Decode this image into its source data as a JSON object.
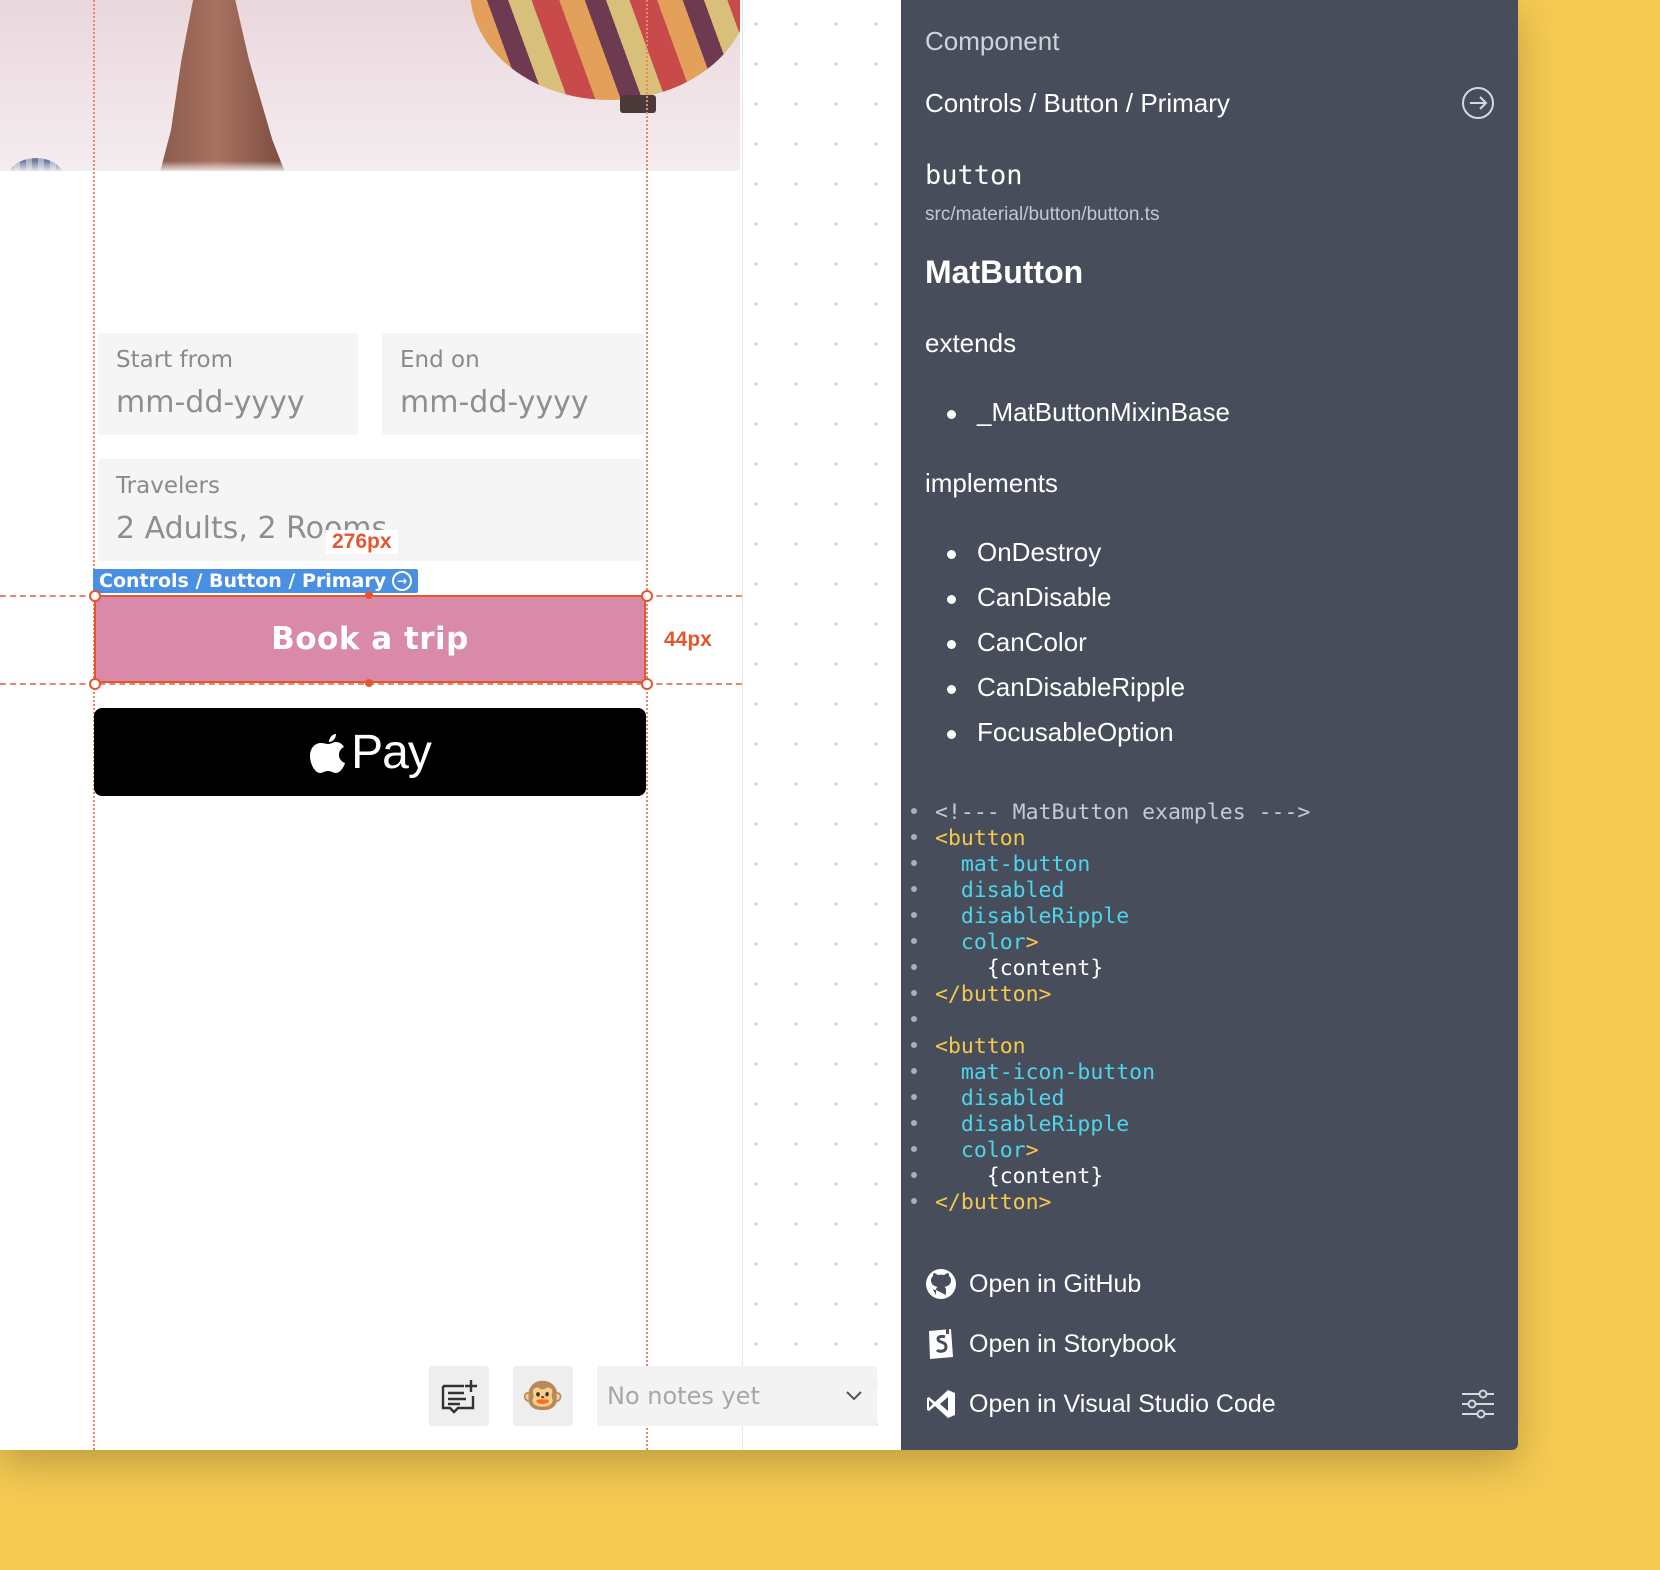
{
  "form": {
    "start_label": "Start from",
    "start_placeholder": "mm-dd-yyyy",
    "end_label": "End on",
    "end_placeholder": "mm-dd-yyyy",
    "travelers_label": "Travelers",
    "travelers_value": "2 Adults, 2 Rooms",
    "book_button": "Book a trip",
    "apple_pay_label": "Pay"
  },
  "inspector": {
    "component_tag": "Controls / Button / Primary",
    "width_measure": "276px",
    "height_measure": "44px"
  },
  "toolbar": {
    "notes_placeholder": "No notes yet",
    "avatar_emoji": "🐵"
  },
  "panel": {
    "heading": "Component",
    "component_path": "Controls / Button / Primary",
    "selector": "button",
    "file_path": "src/material/button/button.ts",
    "class_name": "MatButton",
    "extends_label": "extends",
    "extends_items": [
      "_MatButtonMixinBase"
    ],
    "implements_label": "implements",
    "implements_items": [
      "OnDestroy",
      "CanDisable",
      "CanColor",
      "CanDisableRipple",
      "FocusableOption"
    ],
    "code": {
      "comment": "<!--- MatButton examples --->",
      "open_tag": "<button",
      "attr_mat_button": "mat-button",
      "attr_mat_icon_button": "mat-icon-button",
      "attr_disabled": "disabled",
      "attr_disable_ripple": "disableRipple",
      "attr_color": "color",
      "tag_close_bracket": ">",
      "content": "{content}",
      "close_tag": "</button>"
    },
    "links": {
      "github": "Open in GitHub",
      "storybook": "Open in Storybook",
      "vscode": "Open in Visual Studio Code"
    }
  },
  "colors": {
    "background": "#f5ca52",
    "panel": "#484d5b",
    "primary_button": "#d98aa9",
    "measure": "#e4572e",
    "component_tag": "#4a90e2",
    "code_tag": "#f5c94b",
    "code_attr": "#4fd5e9"
  },
  "icons": [
    "goto-circle-arrow-icon",
    "github-icon",
    "storybook-icon",
    "vscode-icon",
    "settings-sliders-icon",
    "apple-logo-icon",
    "add-note-icon",
    "chevron-down-icon"
  ]
}
